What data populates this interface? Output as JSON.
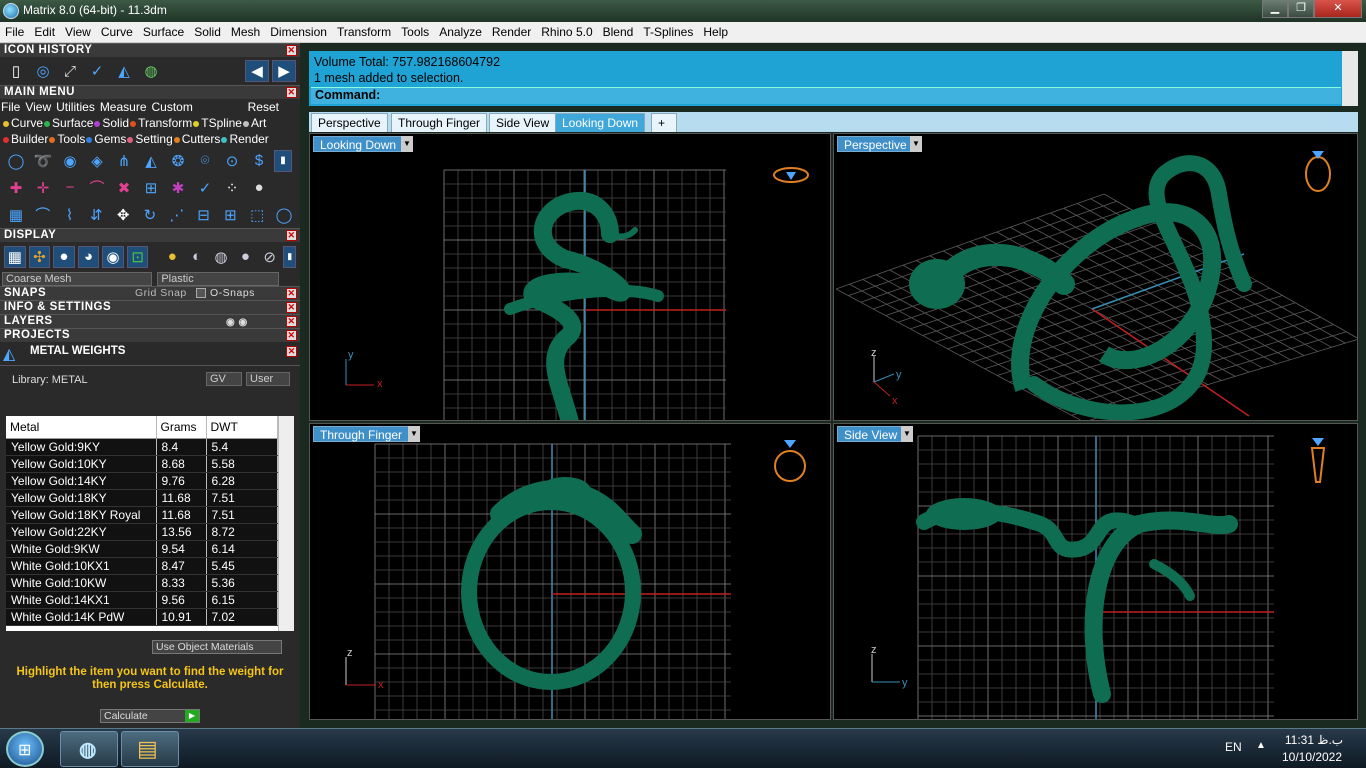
{
  "window": {
    "title": "Matrix 8.0 (64-bit) - 11.3dm",
    "min": "▁",
    "max": "❐",
    "close": "✕"
  },
  "menubar": [
    "File",
    "Edit",
    "View",
    "Curve",
    "Surface",
    "Solid",
    "Mesh",
    "Dimension",
    "Transform",
    "Tools",
    "Analyze",
    "Render",
    "Rhino 5.0",
    "Blend",
    "T-Splines",
    "Help"
  ],
  "left": {
    "icon_history": "ICON HISTORY",
    "main_menu": "MAIN MENU",
    "submenu": [
      "File",
      "View",
      "Utilities",
      "Measure",
      "Custom"
    ],
    "reset": "Reset",
    "cats_row1": [
      {
        "label": "Curve",
        "color": "#e8c030"
      },
      {
        "label": "Surface",
        "color": "#30b050"
      },
      {
        "label": "Solid",
        "color": "#b040d0"
      },
      {
        "label": "Transform",
        "color": "#e05020"
      },
      {
        "label": "TSpline",
        "color": "#e0d020"
      },
      {
        "label": "Art",
        "color": "#c0c0c0"
      }
    ],
    "cats_row2": [
      {
        "label": "Builder",
        "color": "#e03030"
      },
      {
        "label": "Tools",
        "color": "#e07020"
      },
      {
        "label": "Gems",
        "color": "#3080e0"
      },
      {
        "label": "Setting",
        "color": "#e06080"
      },
      {
        "label": "Cutters",
        "color": "#e08020"
      },
      {
        "label": "Render",
        "color": "#40c0c0"
      }
    ],
    "display": "DISPLAY",
    "mesh_mode": "Coarse Mesh",
    "material": "Plastic",
    "snaps": "SNAPS",
    "grid_snap": "Grid Snap",
    "osnaps": "O-Snaps",
    "info": "INFO & SETTINGS",
    "layers": "LAYERS",
    "projects": "PROJECTS",
    "metal_weights": "METAL WEIGHTS",
    "library": "Library: METAL",
    "gv": "GV",
    "user": "User",
    "columns": [
      "Metal",
      "Grams",
      "DWT"
    ],
    "rows": [
      [
        "Yellow Gold:9KY",
        "8.4",
        "5.4"
      ],
      [
        "Yellow Gold:10KY",
        "8.68",
        "5.58"
      ],
      [
        "Yellow Gold:14KY",
        "9.76",
        "6.28"
      ],
      [
        "Yellow Gold:18KY",
        "11.68",
        "7.51"
      ],
      [
        "Yellow Gold:18KY Royal",
        "11.68",
        "7.51"
      ],
      [
        "Yellow Gold:22KY",
        "13.56",
        "8.72"
      ],
      [
        "White Gold:9KW",
        "9.54",
        "6.14"
      ],
      [
        "White Gold:10KX1",
        "8.47",
        "5.45"
      ],
      [
        "White Gold:10KW",
        "8.33",
        "5.36"
      ],
      [
        "White Gold:14KX1",
        "9.56",
        "6.15"
      ],
      [
        "White Gold:14K PdW",
        "10.91",
        "7.02"
      ]
    ],
    "use_obj": "Use Object Materials",
    "hint": "Highlight the item you want to find the weight for then press Calculate.",
    "calculate": "Calculate"
  },
  "command": {
    "line1": "Volume Total: 757.982168604792",
    "line2": "1 mesh added to selection.",
    "prompt": "Command:"
  },
  "tabs": [
    "Perspective",
    "Through Finger",
    "Side View",
    "Looking Down",
    "+"
  ],
  "viewports": {
    "tl": "Looking Down",
    "tr": "Perspective",
    "bl": "Through Finger",
    "br": "Side View"
  },
  "axes": {
    "x": "x",
    "y": "y",
    "z": "z"
  },
  "taskbar": {
    "lang": "EN",
    "time": "11:31 ب.ظ",
    "date": "10/10/2022"
  },
  "colors": {
    "accent": "#1ea3d4",
    "model": "#0f6e52",
    "grid": "#7a7a7a"
  }
}
